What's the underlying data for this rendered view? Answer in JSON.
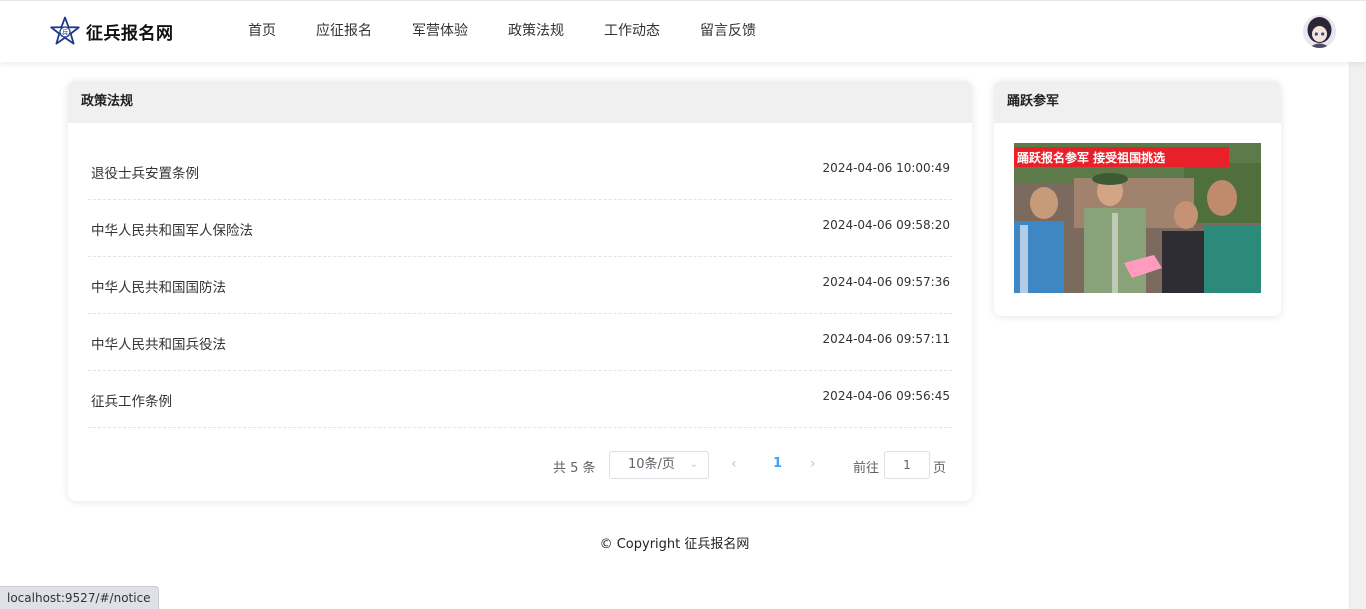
{
  "header": {
    "logo_text": "征兵报名网",
    "nav": [
      {
        "label": "首页"
      },
      {
        "label": "应征报名"
      },
      {
        "label": "军营体验"
      },
      {
        "label": "政策法规"
      },
      {
        "label": "工作动态"
      },
      {
        "label": "留言反馈"
      }
    ]
  },
  "main": {
    "title": "政策法规",
    "items": [
      {
        "title": "退役士兵安置条例",
        "time": "2024-04-06 10:00:49"
      },
      {
        "title": "中华人民共和国军人保险法",
        "time": "2024-04-06 09:58:20"
      },
      {
        "title": "中华人民共和国国防法",
        "time": "2024-04-06 09:57:36"
      },
      {
        "title": "中华人民共和国兵役法",
        "time": "2024-04-06 09:57:11"
      },
      {
        "title": "征兵工作条例",
        "time": "2024-04-06 09:56:45"
      }
    ],
    "pagination": {
      "total": "共 5 条",
      "page_size": "10条/页",
      "current_page": "1",
      "goto_label": "前往",
      "goto_value": "1",
      "page_suffix": "页"
    }
  },
  "sidebar": {
    "title": "踊跃参军",
    "banner_text": "踊跃报名参军  接受祖国挑选"
  },
  "footer": {
    "copyright": "© Copyright 征兵报名网"
  },
  "status_bar": {
    "url": "localhost:9527/#/notice"
  },
  "colors": {
    "accent": "#409eff",
    "logo_star": "#1e3a8a",
    "banner_red": "#e8202a"
  }
}
